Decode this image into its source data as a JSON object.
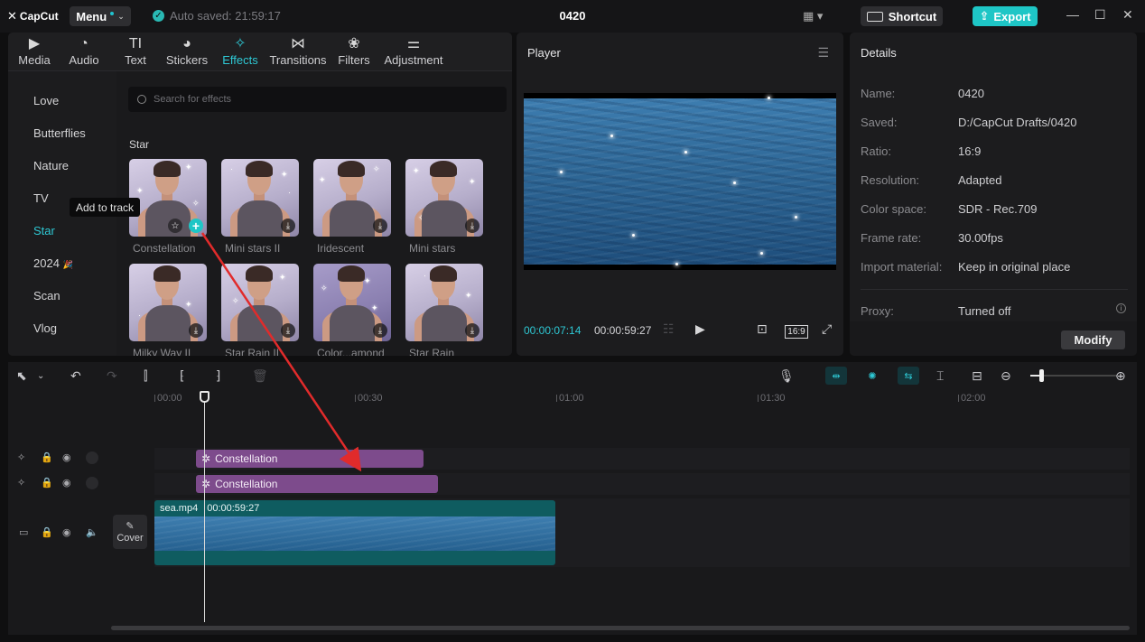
{
  "titlebar": {
    "logo": "CapCut",
    "menu_label": "Menu",
    "autosave": "Auto saved: 21:59:17",
    "project_title": "0420",
    "shortcut_label": "Shortcut",
    "export_label": "Export",
    "accent_color": "#1ec6c6"
  },
  "tabs": [
    {
      "label": "Media",
      "icon": "media-icon"
    },
    {
      "label": "Audio",
      "icon": "audio-icon"
    },
    {
      "label": "Text",
      "icon": "text-icon"
    },
    {
      "label": "Stickers",
      "icon": "stickers-icon"
    },
    {
      "label": "Effects",
      "icon": "effects-icon",
      "active": true
    },
    {
      "label": "Transitions",
      "icon": "transitions-icon"
    },
    {
      "label": "Filters",
      "icon": "filters-icon"
    },
    {
      "label": "Adjustment",
      "icon": "adjustment-icon"
    }
  ],
  "categories": [
    "Love",
    "Butterflies",
    "Nature",
    "TV",
    "Star",
    "2024",
    "Scan",
    "Vlog"
  ],
  "active_category": "Star",
  "search": {
    "placeholder": "Search for effects"
  },
  "section_title": "Star",
  "tooltip": "Add to track",
  "effects": [
    {
      "name": "Constellation",
      "state": "hover"
    },
    {
      "name": "Mini stars II",
      "state": "download"
    },
    {
      "name": "Iridescent",
      "state": "download"
    },
    {
      "name": "Mini stars",
      "state": "download"
    },
    {
      "name": "Milky Way II",
      "state": "download"
    },
    {
      "name": "Star Rain II",
      "state": "download"
    },
    {
      "name": "Color...amond",
      "state": "download"
    },
    {
      "name": "Star Rain",
      "state": "download"
    }
  ],
  "player": {
    "title": "Player",
    "current_time": "00:00:07:14",
    "total_time": "00:00:59:27",
    "ratio": "16:9"
  },
  "details": {
    "title": "Details",
    "rows": [
      {
        "key": "Name:",
        "value": "0420"
      },
      {
        "key": "Saved:",
        "value": "D:/CapCut Drafts/0420"
      },
      {
        "key": "Ratio:",
        "value": "16:9"
      },
      {
        "key": "Resolution:",
        "value": "Adapted"
      },
      {
        "key": "Color space:",
        "value": "SDR - Rec.709"
      },
      {
        "key": "Frame rate:",
        "value": "30.00fps"
      },
      {
        "key": "Import material:",
        "value": "Keep in original place"
      }
    ],
    "proxy_key": "Proxy:",
    "proxy_value": "Turned off",
    "modify_label": "Modify"
  },
  "timeline": {
    "ruler": [
      "00:00",
      "00:30",
      "01:00",
      "01:30",
      "02:00"
    ],
    "fx_clips": [
      "Constellation",
      "Constellation"
    ],
    "video_clip": {
      "name": "sea.mp4",
      "duration": "00:00:59:27"
    },
    "cover_label": "Cover"
  }
}
